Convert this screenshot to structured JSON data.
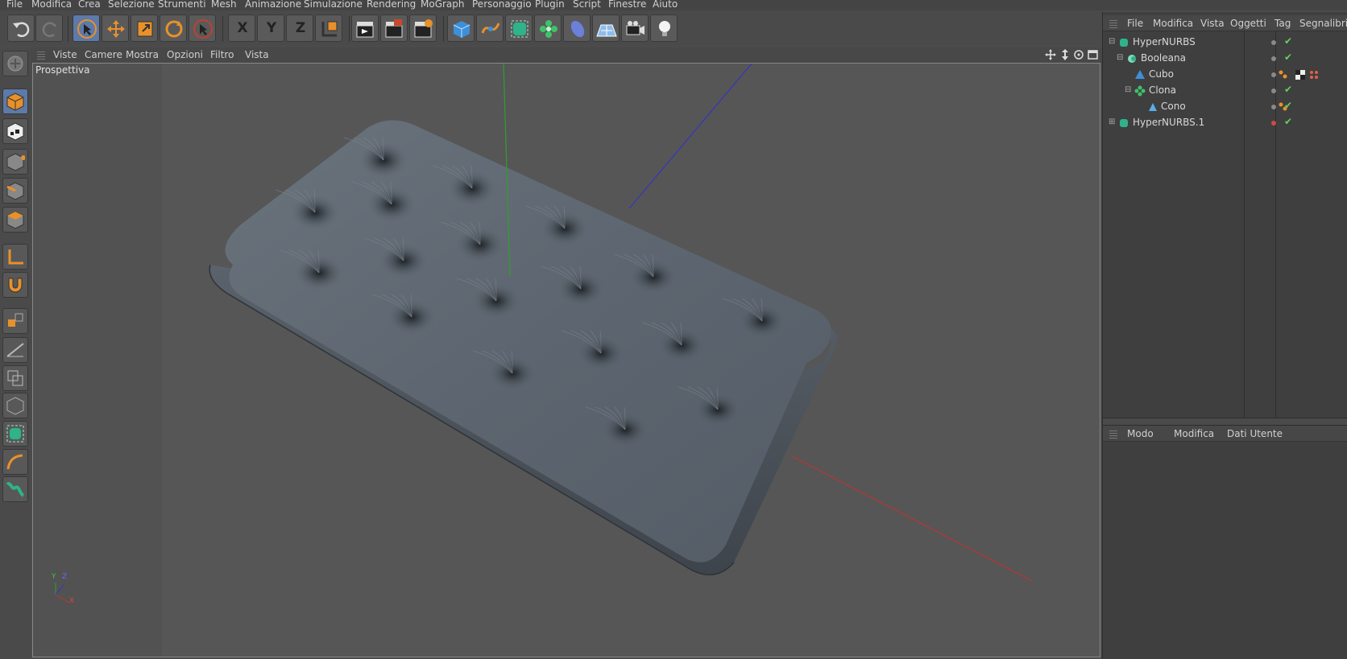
{
  "menu": [
    "File",
    "Modifica",
    "Crea",
    "Selezione",
    "Strumenti",
    "Mesh",
    "Animazione",
    "Simulazione",
    "Rendering",
    "MoGraph",
    "Personaggio",
    "Plugin",
    "Script",
    "Finestre",
    "Aiuto"
  ],
  "toolbar": {
    "undo": "undo-icon",
    "redo": "redo-icon",
    "axis_x": "X",
    "axis_y": "Y",
    "axis_z": "Z"
  },
  "viewport": {
    "menu": [
      "Viste",
      "Camere",
      "Mostra",
      "Opzioni",
      "Filtro",
      "Vista"
    ],
    "label": "Prospettiva",
    "axis_labels": {
      "y": "Y",
      "z": "Z",
      "x": "X"
    }
  },
  "object_manager": {
    "menu": [
      "File",
      "Modifica",
      "Vista",
      "Oggetti",
      "Tag",
      "Segnalibri"
    ],
    "objects": [
      {
        "name": "HyperNURBS",
        "icon": "hypernurbs-icon",
        "checked": true
      },
      {
        "name": "Booleana",
        "icon": "boole-icon",
        "checked": true
      },
      {
        "name": "Cubo",
        "icon": "cube-object-icon",
        "checked": false
      },
      {
        "name": "Clona",
        "icon": "cloner-icon",
        "checked": true
      },
      {
        "name": "Cono",
        "icon": "cone-object-icon",
        "checked": true
      },
      {
        "name": "HyperNURBS.1",
        "icon": "hypernurbs-icon",
        "checked": true
      }
    ]
  },
  "attribute_manager": {
    "menu": [
      "Modo",
      "Modifica",
      "Dati Utente"
    ]
  },
  "colors": {
    "accent_orange": "#e8912a",
    "active_blue": "#5d7aa8",
    "check_green": "#5fd35f",
    "axis_red": "#c83030",
    "axis_green": "#2ea02e",
    "axis_blue": "#3535c0",
    "mesh_color": "#5c6670"
  }
}
